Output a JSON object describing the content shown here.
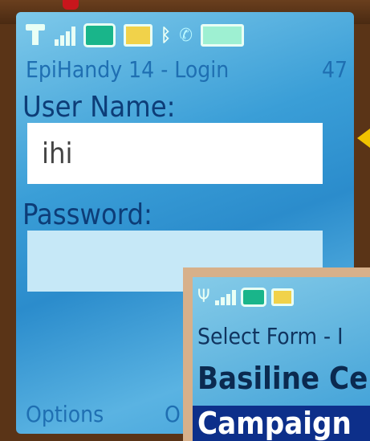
{
  "login": {
    "title": "EpiHandy 14 - Login",
    "counter": "47",
    "user_label": "User Name:",
    "user_value": "ihi",
    "password_label": "Password:",
    "password_value": "",
    "softkey_left": "Options",
    "softkey_middle": "O"
  },
  "overlay": {
    "title": "Select Form - I",
    "items": [
      "Basiline Ce",
      "Campaign"
    ]
  },
  "status_icons": [
    "antenna-icon",
    "signal-bars-icon",
    "phone-icon",
    "message-icon",
    "bluetooth-icon",
    "handset-icon",
    "battery-icon"
  ],
  "colors": {
    "screen_bg": "#3a9ed7",
    "title_text": "#1f6fb2",
    "label_text": "#0d3d78",
    "selected_bg": "#0d2f8a"
  }
}
